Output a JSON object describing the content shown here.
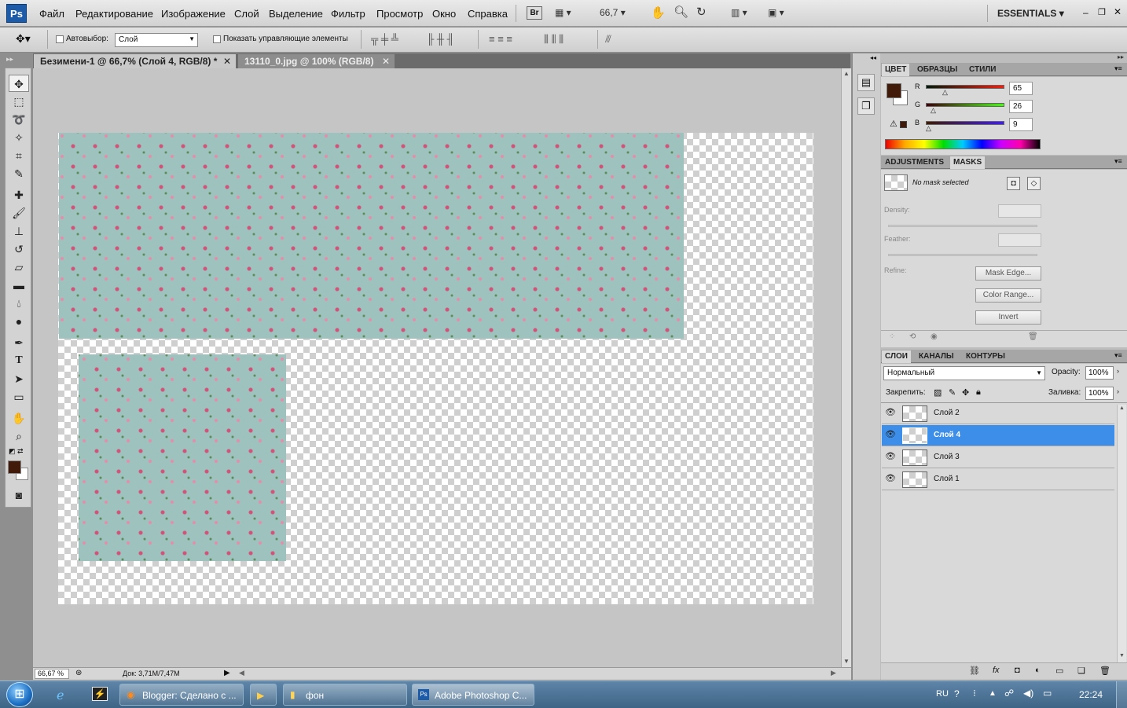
{
  "menubar": {
    "logo": "Ps",
    "items": [
      "Файл",
      "Редактирование",
      "Изображение",
      "Слой",
      "Выделение",
      "Фильтр",
      "Просмотр",
      "Окно",
      "Справка"
    ],
    "zoom": "66,7",
    "workspace": "ESSENTIALS",
    "bridge": "Br"
  },
  "options": {
    "autoselect_label": "Автовыбор:",
    "autoselect_value": "Слой",
    "show_controls_label": "Показать управляющие элементы"
  },
  "tabs": [
    {
      "label": "Безимени-1 @ 66,7% (Слой 4, RGB/8) *",
      "active": true
    },
    {
      "label": "13110_0.jpg @ 100% (RGB/8)",
      "active": false
    }
  ],
  "status": {
    "zoom": "66,67 %",
    "doc": "Док: 3,71М/7,47М"
  },
  "color_panel": {
    "tabs": [
      "ЦВЕТ",
      "ОБРАЗЦЫ",
      "СТИЛИ"
    ],
    "r_label": "R",
    "g_label": "G",
    "b_label": "B",
    "r": "65",
    "g": "26",
    "b": "9",
    "foreground": "#411a09"
  },
  "masks_panel": {
    "tabs": [
      "ADJUSTMENTS",
      "MASKS"
    ],
    "status": "No mask selected",
    "density_label": "Density:",
    "feather_label": "Feather:",
    "refine_label": "Refine:",
    "mask_edge": "Mask Edge...",
    "color_range": "Color Range...",
    "invert": "Invert"
  },
  "layers_panel": {
    "tabs": [
      "СЛОИ",
      "КАНАЛЫ",
      "КОНТУРЫ"
    ],
    "blend_mode": "Нормальный",
    "opacity_label": "Opacity:",
    "opacity": "100%",
    "lock_label": "Закрепить:",
    "fill_label": "Заливка:",
    "fill": "100%",
    "layers": [
      {
        "name": "Слой 2",
        "selected": false
      },
      {
        "name": "Слой 4",
        "selected": true
      },
      {
        "name": "Слой 3",
        "selected": false
      },
      {
        "name": "Слой 1",
        "selected": false
      }
    ]
  },
  "taskbar": {
    "items": [
      "Blogger: Сделано с ...",
      "фон",
      "Adobe Photoshop C..."
    ],
    "lang": "RU",
    "time": "22:24"
  }
}
